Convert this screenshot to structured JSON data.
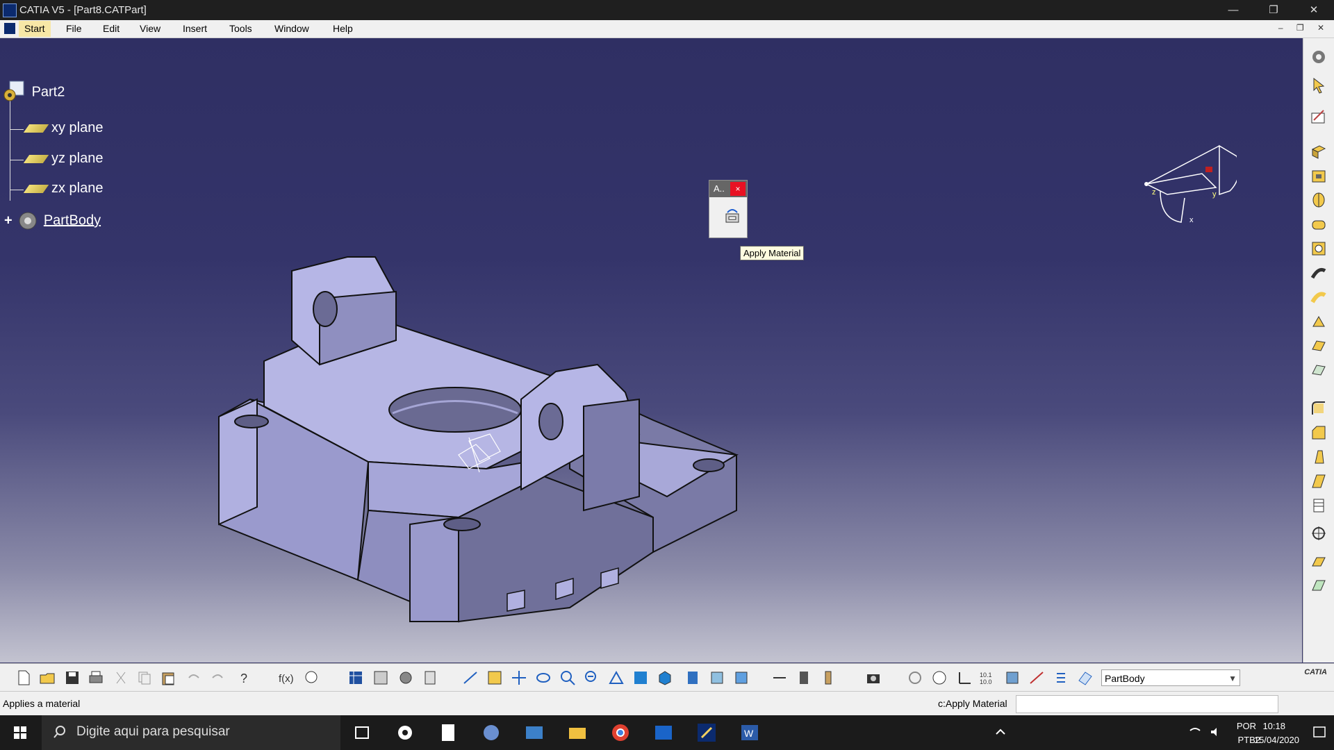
{
  "window": {
    "title": "CATIA V5 - [Part8.CATPart]",
    "controls": [
      "—",
      "❐",
      "✕"
    ]
  },
  "menu": {
    "items": [
      "Start",
      "File",
      "Edit",
      "View",
      "Insert",
      "Tools",
      "Window",
      "Help"
    ],
    "mdi_controls": "– ❐ ✕"
  },
  "tree": {
    "root": "Part2",
    "children": [
      {
        "label": "xy plane",
        "icon": "plane-icon"
      },
      {
        "label": "yz plane",
        "icon": "plane-icon"
      },
      {
        "label": "zx plane",
        "icon": "plane-icon"
      },
      {
        "label": "PartBody",
        "icon": "body-gear-icon",
        "expand": "+"
      }
    ]
  },
  "dialog": {
    "title": "A..",
    "close": "×",
    "tooltip": "Apply Material"
  },
  "compass": {
    "x_label": "x",
    "y_label": "y",
    "z_label": "z"
  },
  "toolbar": {
    "body_select_value": "PartBody",
    "logo_text": "CATIA"
  },
  "status": {
    "message": "Applies a material",
    "command_label": "c:Apply Material",
    "command_value": ""
  },
  "taskbar": {
    "search_placeholder": "Digite aqui para pesquisar",
    "language": "POR",
    "layout": "PTB2",
    "time": "10:18",
    "date": "15/04/2020"
  },
  "colors": {
    "part_light": "#b3b3e0",
    "part_mid": "#9b9bcc",
    "part_dark": "#6c6c93",
    "accent_close": "#e81123"
  }
}
